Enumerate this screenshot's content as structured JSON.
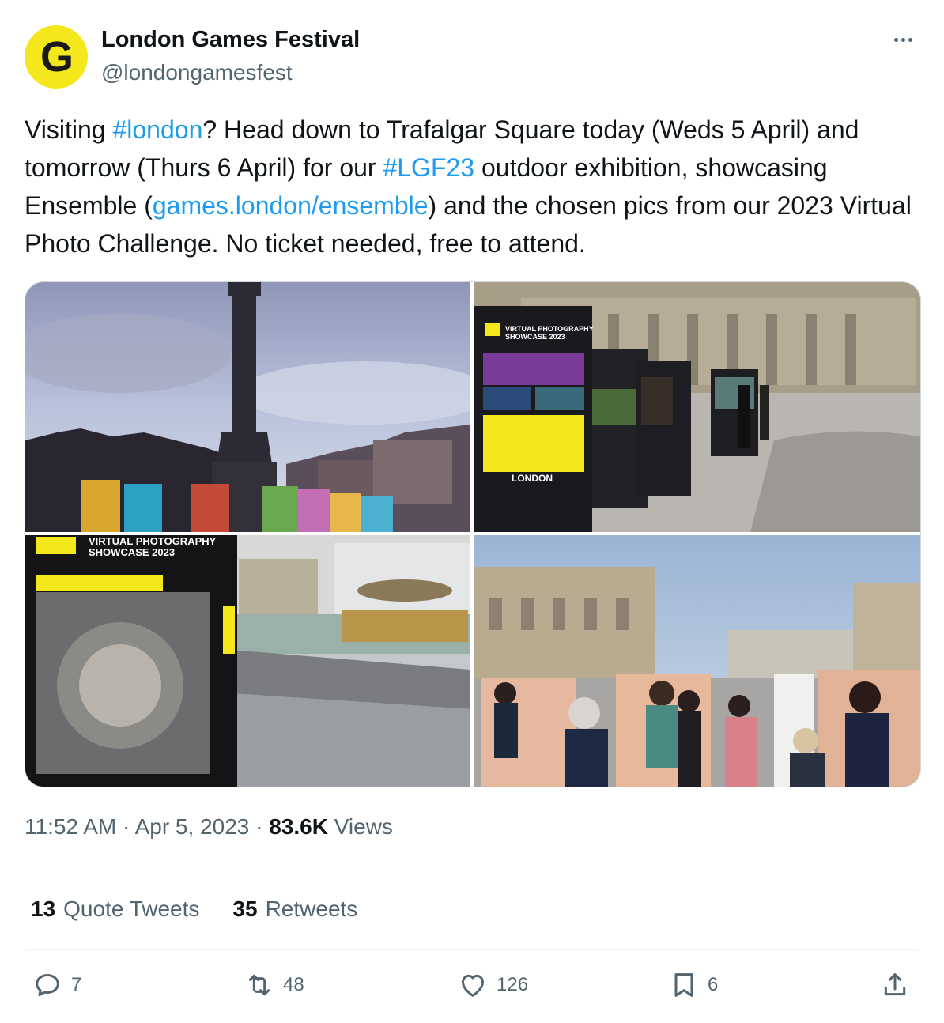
{
  "author": {
    "avatar_letter": "G",
    "name": "London Games Festival",
    "handle": "@londongamesfest"
  },
  "tweet": {
    "t1": "Visiting ",
    "hashtag_london": "#london",
    "t2": "? Head down to  Trafalgar Square today (Weds 5 April) and tomorrow (Thurs 6 April) for our ",
    "hashtag_lgf23": "#LGF23",
    "t3": " outdoor exhibition, showcasing Ensemble (",
    "link": "games.london/ensemble",
    "t4": ") and the chosen pics from our 2023 Virtual Photo Challenge. No ticket needed, free to attend."
  },
  "media": {
    "exhibit_title_line1": "VIRTUAL PHOTOGRAPHY",
    "exhibit_title_line2": "SHOWCASE 2023",
    "exhibit_board_brand": "LONDON"
  },
  "meta": {
    "time": "11:52 AM",
    "sep": " · ",
    "date": "Apr 5, 2023",
    "views_count": "83.6K",
    "views_label": " Views"
  },
  "stats": {
    "quotes_count": "13",
    "quotes_label": "Quote Tweets",
    "retweets_count": "35",
    "retweets_label": "Retweets"
  },
  "actions": {
    "replies": "7",
    "retweets": "48",
    "likes": "126",
    "bookmarks": "6"
  },
  "colors": {
    "link": "#1d9bf0",
    "secondary_text": "#536471",
    "avatar_bg": "#f4e81c"
  }
}
